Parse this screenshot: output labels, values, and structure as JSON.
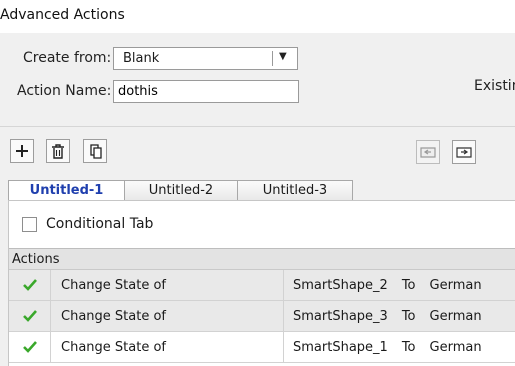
{
  "window": {
    "title": "Advanced Actions"
  },
  "form": {
    "create_from_label": "Create from:",
    "create_from_value": "Blank",
    "action_name_label": "Action Name:",
    "action_name_value": "dothis",
    "existing_label": "Existin"
  },
  "toolbar": {
    "add_icon": "plus-icon",
    "delete_icon": "trash-icon",
    "duplicate_icon": "copy-icon",
    "import_icon": "import-icon",
    "export_icon": "export-icon"
  },
  "tabs": [
    {
      "label": "Untitled-1",
      "active": true
    },
    {
      "label": "Untitled-2",
      "active": false
    },
    {
      "label": "Untitled-3",
      "active": false
    }
  ],
  "conditional": {
    "label": "Conditional Tab",
    "checked": false
  },
  "actions": {
    "header": "Actions",
    "rows": [
      {
        "action": "Change State of",
        "target": "SmartShape_2",
        "to": "To",
        "state": "German"
      },
      {
        "action": "Change State of",
        "target": "SmartShape_3",
        "to": "To",
        "state": "German"
      },
      {
        "action": "Change State of",
        "target": "SmartShape_1",
        "to": "To",
        "state": "German"
      }
    ]
  },
  "colors": {
    "active_tab_text": "#1f3fae",
    "check": "#3aa82b"
  }
}
